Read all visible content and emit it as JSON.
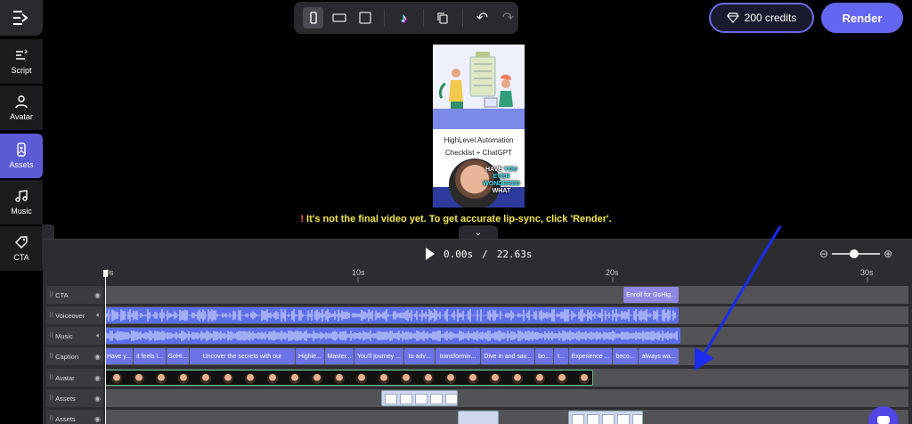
{
  "sidebar": {
    "items": [
      {
        "label": "Script",
        "icon": "script-icon"
      },
      {
        "label": "Avatar",
        "icon": "avatar-icon"
      },
      {
        "label": "Assets",
        "icon": "assets-icon",
        "active": true
      },
      {
        "label": "Music",
        "icon": "music-icon"
      },
      {
        "label": "CTA",
        "icon": "tag-icon"
      }
    ]
  },
  "toolbar": {
    "tiktok_glyph": "♪",
    "undo_glyph": "↶",
    "redo_glyph": "↷"
  },
  "header": {
    "credits_label": "200 credits",
    "render_label": "Render"
  },
  "preview": {
    "title_line1": "HighLevel Automation",
    "title_line2": "Checklist + ChatGPT",
    "overlay_word1": "HAVE",
    "overlay_word2": "YOU",
    "overlay_line2": "EVER",
    "overlay_line3": "WONDERED",
    "overlay_line4": "WHAT"
  },
  "notice": {
    "mark": "!",
    "text": " It's not the final video yet. To get accurate lip-sync, click 'Render'."
  },
  "timeline": {
    "current_time": "0.00s",
    "separator": "/",
    "total_time": "22.63s",
    "ruler_labels": [
      "0s",
      "10s",
      "20s",
      "30s"
    ],
    "tracks": [
      {
        "name": "CTA",
        "icon": "eye"
      },
      {
        "name": "Voiceover",
        "icon": "eye"
      },
      {
        "name": "Music",
        "icon": "eye"
      },
      {
        "name": "Caption",
        "icon": "eye"
      },
      {
        "name": "Avatar",
        "icon": "eye"
      },
      {
        "name": "Assets",
        "icon": "eye"
      },
      {
        "name": "Assets",
        "icon": "eye"
      }
    ],
    "cta_clip": "Enroll for GoHig...",
    "captions": [
      "Have y...",
      "it feels l...",
      "GoHi...",
      "Uncover the secrets with our",
      "Highle...",
      "Master...",
      "You'll journey ...",
      "to adv...",
      "transformin...",
      "Dive in and sav...",
      "bo...",
      "t...",
      "Experience ...",
      "beco...",
      "always wa..."
    ]
  },
  "colors": {
    "accent": "#6366f1",
    "notice": "#f6e94d",
    "wave": "#5b6ee8"
  }
}
